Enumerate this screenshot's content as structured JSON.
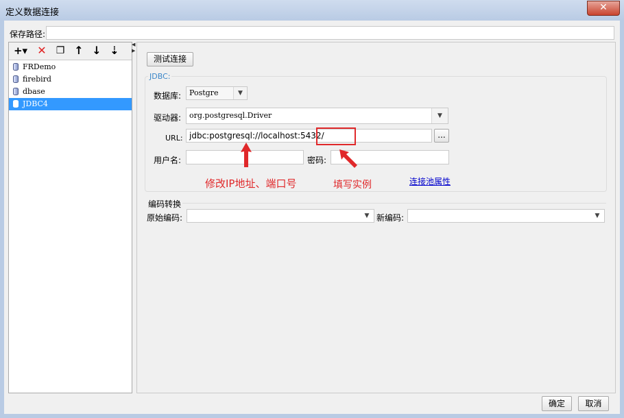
{
  "window": {
    "title": "定义数据连接",
    "close_glyph": "✕"
  },
  "save_path": {
    "label": "保存路径:",
    "value": ""
  },
  "toolbar": {
    "buttons": [
      {
        "name": "add-icon",
        "glyph": "+▾"
      },
      {
        "name": "delete-icon",
        "glyph": "✕",
        "color": "#e02020"
      },
      {
        "name": "copy-icon",
        "glyph": "❐"
      },
      {
        "name": "move-up-icon",
        "glyph": "↑"
      },
      {
        "name": "move-down-icon",
        "glyph": "↓"
      },
      {
        "name": "sort-icon",
        "glyph": "⇣"
      }
    ]
  },
  "connections": {
    "items": [
      {
        "label": "FRDemo",
        "selected": false
      },
      {
        "label": "firebird",
        "selected": false
      },
      {
        "label": "dbase",
        "selected": false
      },
      {
        "label": "JDBC4",
        "selected": true
      }
    ],
    "selected_color": "#3399ff"
  },
  "test_button": {
    "label": "测试连接"
  },
  "jdbc": {
    "legend": "JDBC:",
    "database_label": "数据库:",
    "database_value": "Postgre",
    "driver_label": "驱动器:",
    "driver_value": "org.postgresql.Driver",
    "url_label": "URL:",
    "url_value": "jdbc:postgresql://localhost:5432/",
    "url_browse": "...",
    "username_label": "用户名:",
    "username_value": "",
    "password_label": "密码:",
    "password_value": "",
    "pool_link": "连接池属性"
  },
  "annotations": {
    "ip_port": "修改IP地址、端口号",
    "instance": "填写实例",
    "color": "#e0282a"
  },
  "encoding": {
    "section_label": "编码转换",
    "original_label": "原始编码:",
    "original_value": "",
    "new_label": "新编码:",
    "new_value": ""
  },
  "dialog_buttons": {
    "ok": "确定",
    "cancel": "取消"
  }
}
